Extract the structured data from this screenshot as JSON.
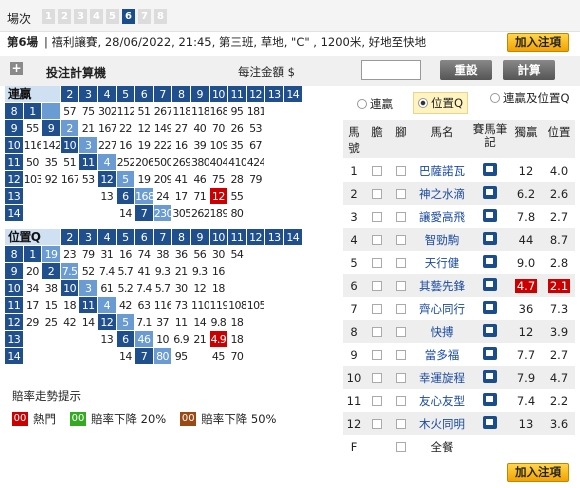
{
  "race_nav": {
    "label": "場次",
    "races": [
      "1",
      "2",
      "3",
      "4",
      "5",
      "6",
      "7",
      "8"
    ],
    "selected": "6"
  },
  "race_info": {
    "race_no": "第6場",
    "details": "禧利讓賽, 28/06/2022, 21:45, 第三班, 草地, \"C\" , 1200米, 好地至快地"
  },
  "add_bet_label": "加入注項",
  "calculator": {
    "title": "投注計算機",
    "amount_label": "每注金額 $",
    "amount_value": "",
    "reset_label": "重設",
    "calc_label": "計算"
  },
  "quinella_title": "連贏",
  "place_q_title": "位置Q",
  "col_nums": [
    "2",
    "3",
    "4",
    "5",
    "6",
    "7",
    "8",
    "9",
    "10",
    "11",
    "12",
    "13",
    "14"
  ],
  "quinella": [
    [
      "8",
      "1",
      "",
      "57",
      "75",
      "302",
      "112",
      "51",
      "267",
      "118",
      "118",
      "168",
      "95",
      "181"
    ],
    [
      "9",
      "55",
      "9",
      "2",
      "21",
      "167",
      "22",
      "12",
      "149",
      "27",
      "40",
      "70",
      "26",
      "53"
    ],
    [
      "10",
      "116",
      "142",
      "10",
      "3",
      "227",
      "16",
      "19",
      "222",
      "16",
      "39",
      "109",
      "35",
      "67"
    ],
    [
      "11",
      "50",
      "35",
      "51",
      "11",
      "4",
      "252",
      "206",
      "500",
      "269",
      "380",
      "404",
      "410",
      "424"
    ],
    [
      "12",
      "103",
      "92",
      "167",
      "53",
      "12",
      "5",
      "19",
      "209",
      "41",
      "46",
      "75",
      "28",
      "79"
    ],
    [
      "13",
      "",
      "",
      "",
      "",
      "13",
      "6",
      "168",
      "24",
      "17",
      "71",
      "12",
      "55",
      ""
    ],
    [
      "14",
      "",
      "",
      "",
      "",
      "",
      "14",
      "7",
      "230",
      "305",
      "262",
      "189",
      "80",
      ""
    ]
  ],
  "place_q": [
    [
      "8",
      "1",
      "19",
      "23",
      "79",
      "31",
      "16",
      "74",
      "38",
      "36",
      "56",
      "30",
      "54",
      ""
    ],
    [
      "9",
      "20",
      "2",
      "7.5",
      "52",
      "7.4",
      "5.7",
      "41",
      "9.3",
      "21",
      "9.3",
      "16",
      "",
      ""
    ],
    [
      "10",
      "34",
      "38",
      "10",
      "3",
      "61",
      "5.2",
      "7.4",
      "5.7",
      "30",
      "12",
      "18",
      "",
      ""
    ],
    [
      "11",
      "17",
      "15",
      "18",
      "11",
      "4",
      "42",
      "63",
      "116",
      "73",
      "110",
      "119",
      "108",
      "105"
    ],
    [
      "12",
      "29",
      "25",
      "42",
      "14",
      "12",
      "5",
      "7.1",
      "37",
      "11",
      "14",
      "9.8",
      "18",
      ""
    ],
    [
      "13",
      "",
      "",
      "",
      "",
      "13",
      "6",
      "46",
      "10",
      "6.9",
      "21",
      "4.9",
      "18",
      ""
    ],
    [
      "14",
      "",
      "",
      "",
      "",
      "",
      "14",
      "7",
      "80",
      "95",
      "",
      "45",
      "70",
      ""
    ]
  ],
  "legend": {
    "title": "賠率走勢提示",
    "items": [
      {
        "badge": "00",
        "label": "熱門",
        "color": "#cc0000"
      },
      {
        "badge": "00",
        "label": "賠率下降 20%",
        "color": "#33aa22"
      },
      {
        "badge": "00",
        "label": "賠率下降 50%",
        "color": "#9b4a14"
      }
    ]
  },
  "pool_options": {
    "opt1": "連贏",
    "opt2": "位置Q",
    "opt3": "連贏及位置Q",
    "selected": "位置Q"
  },
  "table_headers": {
    "no": "馬號",
    "banker": "膽",
    "leg": "腳",
    "name": "馬名",
    "form": "賽馬筆記",
    "win": "獨贏",
    "place": "位置"
  },
  "runners": [
    {
      "no": "1",
      "name": "巴薩諾瓦",
      "win": "12",
      "place": "4.0"
    },
    {
      "no": "2",
      "name": "神之水滴",
      "win": "6.2",
      "place": "2.6"
    },
    {
      "no": "3",
      "name": "讓愛高飛",
      "win": "7.8",
      "place": "2.7"
    },
    {
      "no": "4",
      "name": "智勁駒",
      "win": "44",
      "place": "8.7"
    },
    {
      "no": "5",
      "name": "天行健",
      "win": "9.0",
      "place": "2.8"
    },
    {
      "no": "6",
      "name": "其藝先鋒",
      "win": "4.7",
      "place": "2.1"
    },
    {
      "no": "7",
      "name": "齊心同行",
      "win": "36",
      "place": "7.3"
    },
    {
      "no": "8",
      "name": "快搏",
      "win": "12",
      "place": "3.9"
    },
    {
      "no": "9",
      "name": "當多福",
      "win": "7.7",
      "place": "2.7"
    },
    {
      "no": "10",
      "name": "幸運旋程",
      "win": "7.9",
      "place": "4.7"
    },
    {
      "no": "11",
      "name": "友心友型",
      "win": "7.4",
      "place": "2.2"
    },
    {
      "no": "12",
      "name": "木火同明",
      "win": "13",
      "place": "3.6"
    }
  ],
  "field_row": {
    "no": "F",
    "name": "全餐"
  }
}
